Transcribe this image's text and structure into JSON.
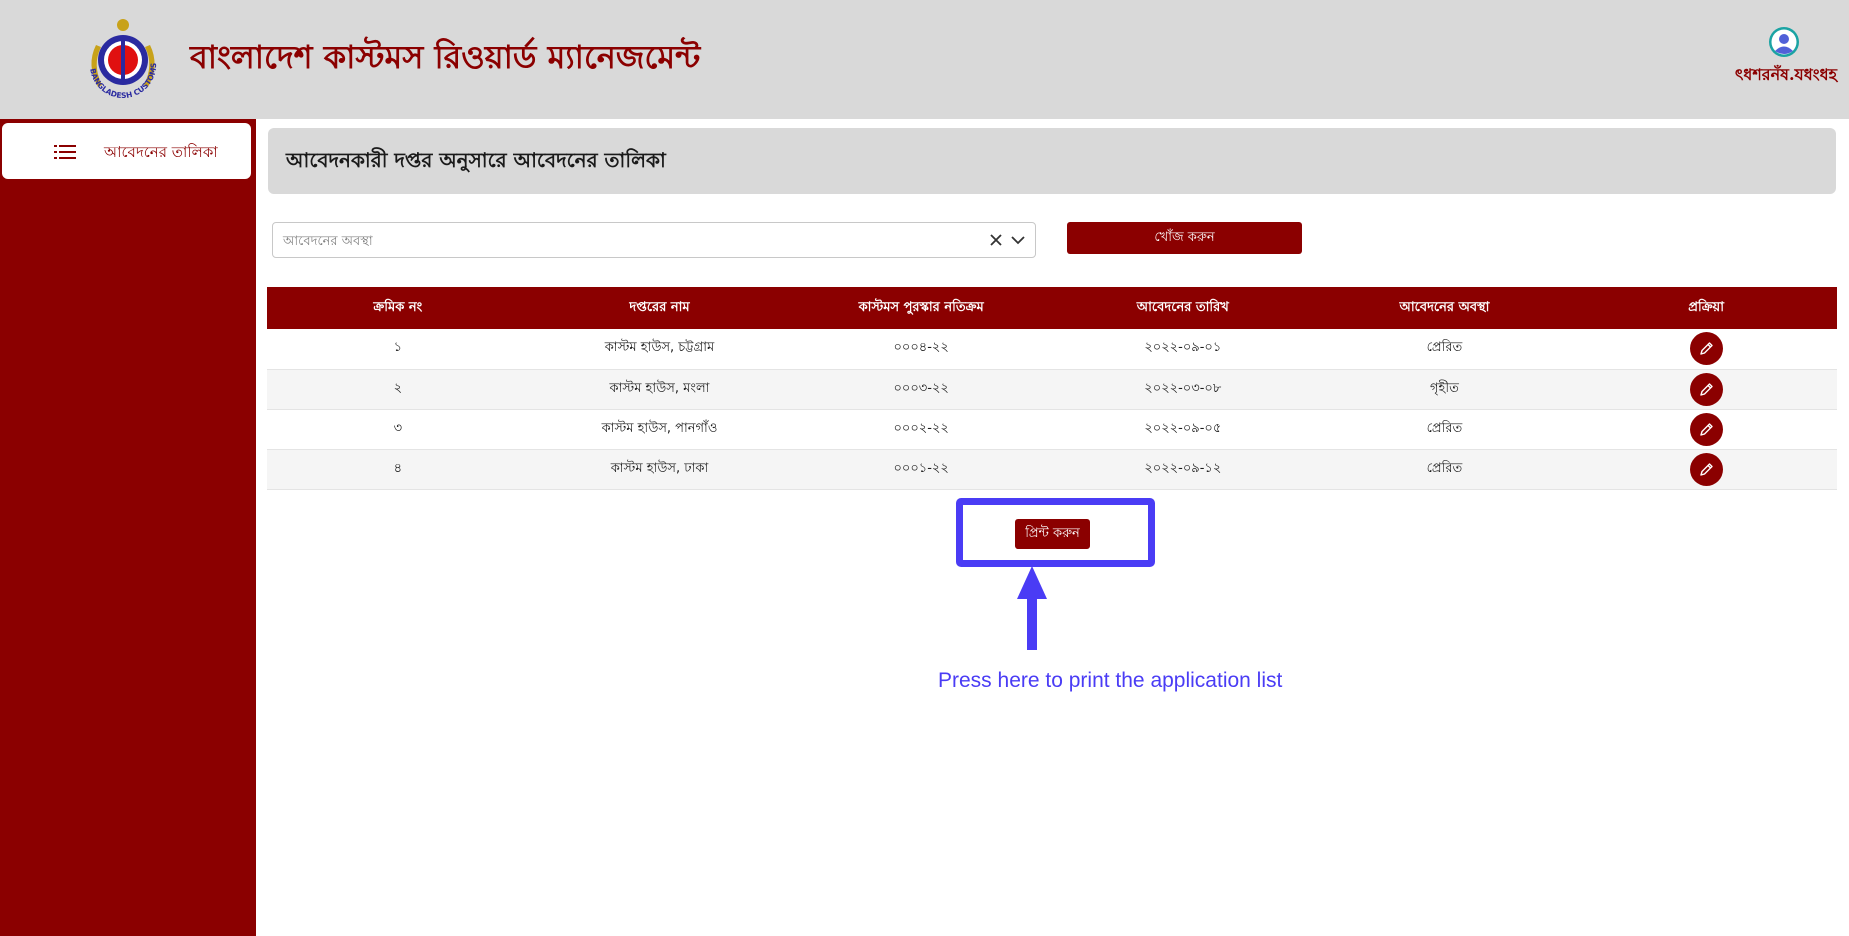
{
  "header": {
    "title": "বাংলাদেশ কাস্টমস রিওয়ার্ড ম্যানেজমেন্ট",
    "user_name": "ৎধশরনঁষ.যধংধহ",
    "logo_text": "BANGLADESH CUSTOMS & VAT"
  },
  "sidebar": {
    "items": [
      {
        "label": "আবেদনের তালিকা",
        "icon": "list-icon"
      }
    ]
  },
  "main": {
    "title": "আবেদনকারী দপ্তর অনুসারে আবেদনের তালিকা",
    "status_select": {
      "placeholder": "আবেদনের অবস্থা"
    },
    "search_label": "খোঁজ করুন",
    "table": {
      "headers": [
        "ক্রমিক নং",
        "দপ্তরের নাম",
        "কাস্টমস পুরস্কার নতিক্রম",
        "আবেদনের তারিখ",
        "আবেদনের অবস্থা",
        "প্রক্রিয়া"
      ],
      "rows": [
        {
          "serial": "১",
          "office": "কাস্টম হাউস, চট্টগ্রাম",
          "ref": "০০০৪-২২",
          "date": "২০২২-০৯-০১",
          "status": "প্রেরিত"
        },
        {
          "serial": "২",
          "office": "কাস্টম হাউস, মংলা",
          "ref": "০০০৩-২২",
          "date": "২০২২-০৩-০৮",
          "status": "গৃহীত"
        },
        {
          "serial": "৩",
          "office": "কাস্টম হাউস, পানগাঁও",
          "ref": "০০০২-২২",
          "date": "২০২২-০৯-০৫",
          "status": "প্রেরিত"
        },
        {
          "serial": "৪",
          "office": "কাস্টম হাউস, ঢাকা",
          "ref": "০০০১-২২",
          "date": "২০২২-০৯-১২",
          "status": "প্রেরিত"
        }
      ]
    },
    "print_label": "প্রিন্ট করুন",
    "annotation": "Press here to print the application list"
  },
  "colors": {
    "brand": "#8b0000",
    "header_bg": "#d9d9d9",
    "annotation": "#4a3cf5"
  }
}
